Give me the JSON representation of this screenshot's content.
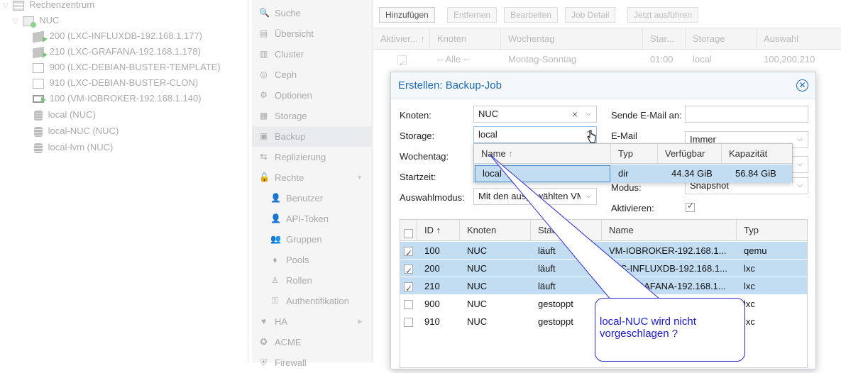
{
  "tree": {
    "items": [
      {
        "label": "Rechenzentrum",
        "icon": "server-icon"
      },
      {
        "label": "NUC",
        "icon": "node-online-icon"
      },
      {
        "label": "200 (LXC-INFLUXDB-192.168.1.177)",
        "icon": "container-running-icon"
      },
      {
        "label": "210 (LXC-GRAFANA-192.168.1.178)",
        "icon": "container-running-icon"
      },
      {
        "label": "900 (LXC-DEBIAN-BUSTER-TEMPLATE)",
        "icon": "template-icon"
      },
      {
        "label": "910 (LXC-DEBIAN-BUSTER-CLON)",
        "icon": "container-stopped-icon"
      },
      {
        "label": "100 (VM-IOBROKER-192.168.1.140)",
        "icon": "vm-running-icon"
      },
      {
        "label": "local (NUC)",
        "icon": "storage-icon"
      },
      {
        "label": "local-NUC (NUC)",
        "icon": "storage-icon"
      },
      {
        "label": "local-lvm (NUC)",
        "icon": "storage-icon"
      }
    ]
  },
  "menu": {
    "items": [
      {
        "label": "Suche",
        "icon": "search-icon",
        "glyph": "🔍"
      },
      {
        "label": "Übersicht",
        "icon": "book-icon",
        "glyph": "▤"
      },
      {
        "label": "Cluster",
        "icon": "server-icon",
        "glyph": "▥"
      },
      {
        "label": "Ceph",
        "icon": "ceph-icon",
        "glyph": "◎"
      },
      {
        "label": "Optionen",
        "icon": "gear-icon",
        "glyph": "⚙"
      },
      {
        "label": "Storage",
        "icon": "database-icon",
        "glyph": "▦"
      },
      {
        "label": "Backup",
        "icon": "floppy-icon",
        "glyph": "▣"
      },
      {
        "label": "Replizierung",
        "icon": "retweet-icon",
        "glyph": "⇆"
      },
      {
        "label": "Rechte",
        "icon": "unlock-icon",
        "glyph": "🔓"
      },
      {
        "label": "Benutzer",
        "icon": "user-icon",
        "glyph": "👤"
      },
      {
        "label": "API-Token",
        "icon": "user-outline-icon",
        "glyph": "👤"
      },
      {
        "label": "Gruppen",
        "icon": "users-icon",
        "glyph": "👥"
      },
      {
        "label": "Pools",
        "icon": "tags-icon",
        "glyph": "⬧"
      },
      {
        "label": "Rollen",
        "icon": "male-icon",
        "glyph": "♙"
      },
      {
        "label": "Authentifikation",
        "icon": "key-icon",
        "glyph": "⚿"
      },
      {
        "label": "HA",
        "icon": "heartbeat-icon",
        "glyph": "♥"
      },
      {
        "label": "ACME",
        "icon": "certificate-icon",
        "glyph": "✪"
      },
      {
        "label": "Firewall",
        "icon": "shield-icon",
        "glyph": "⛨"
      }
    ]
  },
  "toolbar": {
    "add": "Hinzufügen",
    "remove": "Entfernen",
    "edit": "Bearbeiten",
    "detail": "Job Detail",
    "run": "Jetzt ausführen"
  },
  "jobs_table": {
    "headers": [
      "Aktivier...",
      "Knoten",
      "Wochentag",
      "Star...",
      "Storage",
      "Auswahl"
    ],
    "rows": [
      {
        "enabled": true,
        "node": "-- Alle --",
        "day": "Montag-Sonntag",
        "start": "01:00",
        "storage": "local",
        "selection": "100,200,210"
      }
    ]
  },
  "dialog": {
    "title": "Erstellen: Backup-Job",
    "labels": {
      "node": "Knoten:",
      "storage": "Storage:",
      "weekday": "Wochentag:",
      "starttime": "Startzeit:",
      "selection_mode": "Auswahlmodus:",
      "email": "Sende E-Mail an:",
      "email_notify": "E-Mail",
      "mode": "Modus:",
      "enable": "Aktivieren:"
    },
    "values": {
      "node": "NUC",
      "storage": "local",
      "selection_mode": "Mit den ausgewählten VMs",
      "email": "",
      "email_notify": "Immer",
      "mode": "Snapshot",
      "enable": true
    },
    "guest_table": {
      "headers": [
        "ID",
        "Knoten",
        "Status",
        "Name",
        "Typ"
      ],
      "rows": [
        {
          "selected": true,
          "id": "100",
          "node": "NUC",
          "status": "läuft",
          "name": "VM-IOBROKER-192.168.1...",
          "type": "qemu"
        },
        {
          "selected": true,
          "id": "200",
          "node": "NUC",
          "status": "läuft",
          "name": "LXC-INFLUXDB-192.168.1...",
          "type": "lxc"
        },
        {
          "selected": true,
          "id": "210",
          "node": "NUC",
          "status": "läuft",
          "name": "LXC-GRAFANA-192.168.1...",
          "type": "lxc"
        },
        {
          "selected": false,
          "id": "900",
          "node": "NUC",
          "status": "gestoppt",
          "name": "",
          "type": "lxc"
        },
        {
          "selected": false,
          "id": "910",
          "node": "NUC",
          "status": "gestoppt",
          "name": "",
          "type": "lxc"
        }
      ]
    },
    "storage_picker": {
      "headers": [
        "Name",
        "Typ",
        "Verfügbar",
        "Kapazität"
      ],
      "rows": [
        {
          "name": "local",
          "type": "dir",
          "available": "44.34 GiB",
          "capacity": "56.84 GiB"
        }
      ]
    }
  },
  "annotation": {
    "text": "local-NUC wird nicht vorgeschlagen ?"
  },
  "colors": {
    "accent": "#1f6ab1",
    "selection": "#c2ddf2",
    "annotation": "#1a1ac8"
  }
}
